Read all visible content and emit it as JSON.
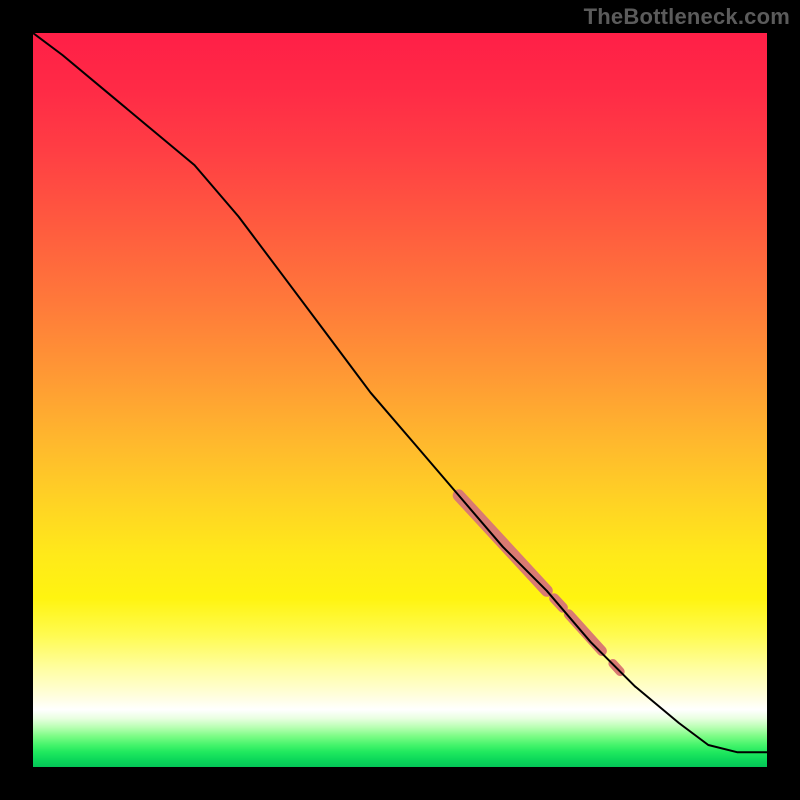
{
  "watermark": "TheBottleneck.com",
  "chart_data": {
    "type": "line",
    "title": "",
    "xlabel": "",
    "ylabel": "",
    "xlim": [
      0,
      100
    ],
    "ylim": [
      0,
      100
    ],
    "grid": false,
    "series": [
      {
        "name": "curve",
        "color": "#000000",
        "stroke_width": 2,
        "x": [
          0,
          4,
          10,
          16,
          22,
          28,
          34,
          40,
          46,
          52,
          58,
          64,
          70,
          76,
          82,
          88,
          92,
          96,
          100
        ],
        "y": [
          100,
          97,
          92,
          87,
          82,
          75,
          67,
          59,
          51,
          44,
          37,
          30,
          24,
          17,
          11,
          6,
          3,
          2,
          2
        ]
      }
    ],
    "highlight_segments": [
      {
        "name": "thick-segment-upper",
        "color": "#d97a72",
        "width": 12,
        "x": [
          58,
          70
        ],
        "y": [
          37,
          24
        ]
      },
      {
        "name": "dot-mid-1",
        "color": "#d97a72",
        "width": 10,
        "x": [
          71,
          72.2
        ],
        "y": [
          23,
          21.7
        ]
      },
      {
        "name": "thick-segment-lower",
        "color": "#d97a72",
        "width": 10,
        "x": [
          73,
          77.5
        ],
        "y": [
          20.8,
          15.8
        ]
      },
      {
        "name": "dot-mid-2",
        "color": "#d97a72",
        "width": 9,
        "x": [
          79,
          80
        ],
        "y": [
          14.1,
          13
        ]
      }
    ]
  }
}
